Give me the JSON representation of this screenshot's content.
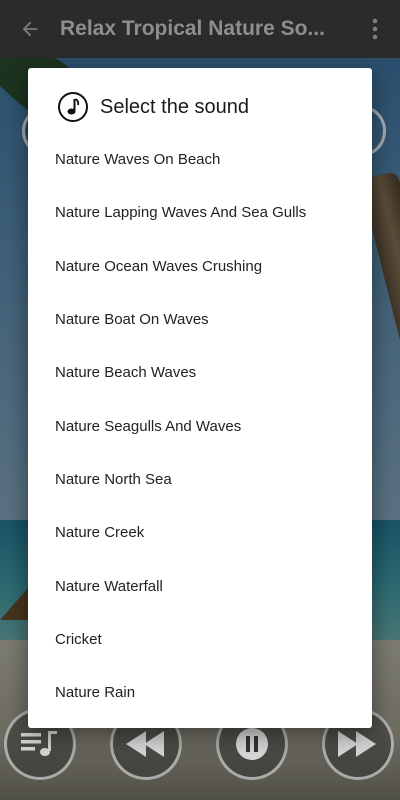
{
  "app": {
    "title": "Relax Tropical Nature So..."
  },
  "dialog": {
    "title": "Select the sound",
    "items": [
      "Nature Waves On Beach",
      "Nature Lapping Waves And Sea Gulls",
      "Nature Ocean Waves Crushing",
      "Nature Boat On Waves",
      "Nature Beach Waves",
      "Nature Seagulls And Waves",
      "Nature North Sea",
      "Nature Creek",
      "Nature Waterfall",
      "Cricket",
      "Nature Rain"
    ]
  },
  "icons": {
    "back": "arrow-left-icon",
    "menu": "more-vert-icon",
    "note": "music-note-icon",
    "playlist": "playlist-music-icon",
    "rewind": "rewind-icon",
    "pause": "pause-icon",
    "forward": "fast-forward-icon"
  },
  "colors": {
    "appbar": "#2b2b2b",
    "title": "#8e8e8e",
    "dialog_bg": "#ffffff"
  }
}
